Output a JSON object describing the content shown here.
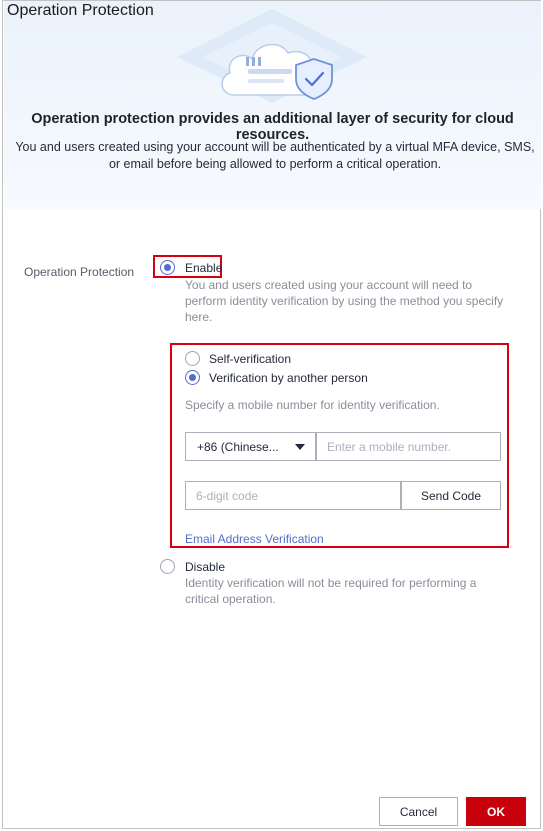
{
  "dialog": {
    "title": "Operation Protection"
  },
  "banner": {
    "heading": "Operation protection provides an additional layer of security for cloud resources.",
    "description": "You and users created using your account will be authenticated by a virtual MFA device, SMS, or email before being allowed to perform a critical operation."
  },
  "form": {
    "field_label": "Operation Protection",
    "enable": {
      "label": "Enable",
      "selected": true,
      "description_lines": [
        "You and users created using your account will need to",
        "perform identity verification by using the method you specify",
        "here."
      ]
    },
    "verification": {
      "self_label": "Self-verification",
      "self_selected": false,
      "other_label": "Verification by another person",
      "other_selected": true,
      "hint": "Specify a mobile number for identity verification.",
      "country_code": "+86 (Chinese...",
      "mobile_placeholder": "Enter a mobile number.",
      "code_placeholder": "6-digit code",
      "send_code_label": "Send Code",
      "email_link": "Email Address Verification"
    },
    "disable": {
      "label": "Disable",
      "selected": false,
      "description_lines": [
        "Identity verification will not be required for performing a",
        "critical operation."
      ]
    }
  },
  "footer": {
    "cancel_label": "Cancel",
    "ok_label": "OK"
  },
  "colors": {
    "accent": "#526ecc",
    "primary_button": "#c7000b",
    "highlight_border": "#d6000f"
  },
  "icons": [
    "cloud-shield-illustration",
    "caret-down-icon"
  ]
}
